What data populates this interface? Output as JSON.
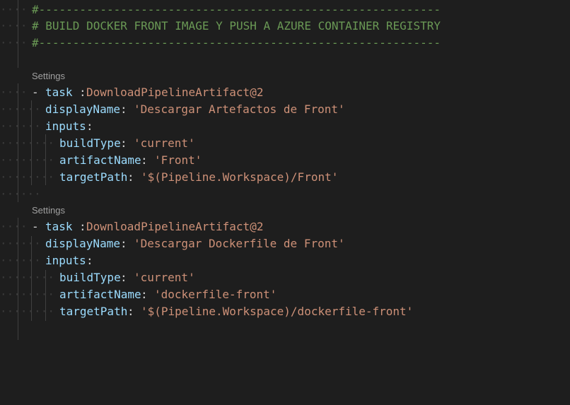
{
  "theme": {
    "background": "#1e1e1e",
    "comment_color": "#6a9955",
    "key_color": "#9cdcfe",
    "string_color": "#ce9178",
    "codelens_color": "#a0a0a0"
  },
  "header_comment": {
    "line1": "#-----------------------------------------------------------",
    "line2": "# BUILD DOCKER FRONT IMAGE Y PUSH A AZURE CONTAINER REGISTRY",
    "line3": "#-----------------------------------------------------------"
  },
  "tasks": [
    {
      "codelens": "Settings",
      "dash": "-",
      "task_key": "task",
      "task_value": "DownloadPipelineArtifact@2",
      "display_key": "displayName",
      "display_value": "'Descargar Artefactos de Front'",
      "inputs_key": "inputs",
      "build_key": "buildType",
      "build_value": "'current'",
      "artifact_key": "artifactName",
      "artifact_value": "'Front'",
      "path_key": "targetPath",
      "path_value": "'$(Pipeline.Workspace)/Front'"
    },
    {
      "codelens": "Settings",
      "dash": "-",
      "task_key": "task",
      "task_value": "DownloadPipelineArtifact@2",
      "display_key": "displayName",
      "display_value": "'Descargar Dockerfile de Front'",
      "inputs_key": "inputs",
      "build_key": "buildType",
      "build_value": "'current'",
      "artifact_key": "artifactName",
      "artifact_value": "'dockerfile-front'",
      "path_key": "targetPath",
      "path_value": "'$(Pipeline.Workspace)/dockerfile-front'"
    }
  ],
  "colon": ":"
}
